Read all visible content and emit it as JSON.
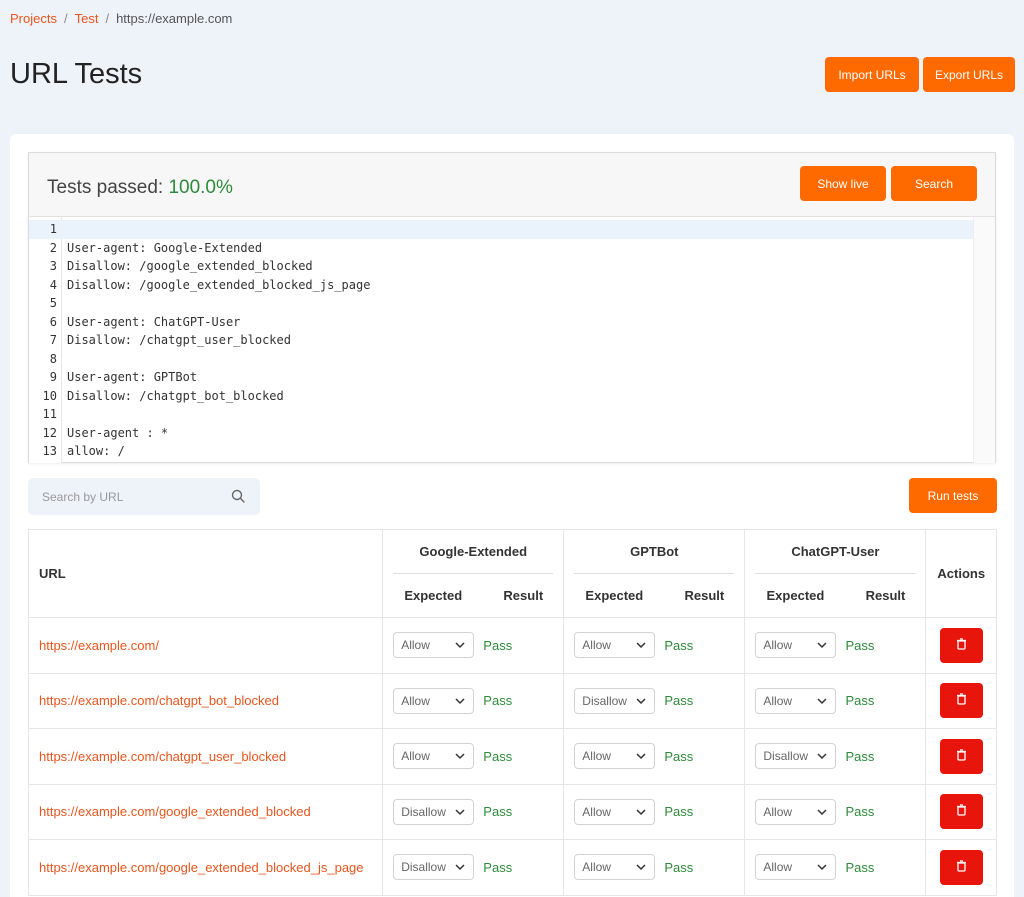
{
  "breadcrumb": {
    "projects": "Projects",
    "test": "Test",
    "current": "https://example.com",
    "separator": "/"
  },
  "page_title": "URL Tests",
  "header_buttons": {
    "import": "Import URLs",
    "export": "Export URLs"
  },
  "editor": {
    "tests_passed_label": "Tests passed:",
    "tests_passed_value": "100.0%",
    "show_live": "Show live",
    "search": "Search",
    "lines": [
      {
        "n": "1",
        "text": ""
      },
      {
        "n": "2",
        "text": "User-agent: Google-Extended"
      },
      {
        "n": "3",
        "text": "Disallow: /google_extended_blocked"
      },
      {
        "n": "4",
        "text": "Disallow: /google_extended_blocked_js_page"
      },
      {
        "n": "5",
        "text": ""
      },
      {
        "n": "6",
        "text": "User-agent: ChatGPT-User"
      },
      {
        "n": "7",
        "text": "Disallow: /chatgpt_user_blocked"
      },
      {
        "n": "8",
        "text": ""
      },
      {
        "n": "9",
        "text": "User-agent: GPTBot"
      },
      {
        "n": "10",
        "text": "Disallow: /chatgpt_bot_blocked"
      },
      {
        "n": "11",
        "text": ""
      },
      {
        "n": "12",
        "text": "User-agent : *"
      },
      {
        "n": "13",
        "text": "allow: /"
      }
    ]
  },
  "search": {
    "placeholder": "Search by URL"
  },
  "run_tests": "Run tests",
  "table": {
    "url_header": "URL",
    "groups": [
      "Google-Extended",
      "GPTBot",
      "ChatGPT-User"
    ],
    "expected_header": "Expected",
    "result_header": "Result",
    "actions_header": "Actions",
    "rows": [
      {
        "url": "https://example.com/",
        "cells": [
          {
            "expected": "Allow",
            "result": "Pass"
          },
          {
            "expected": "Allow",
            "result": "Pass"
          },
          {
            "expected": "Allow",
            "result": "Pass"
          }
        ]
      },
      {
        "url": "https://example.com/chatgpt_bot_blocked",
        "cells": [
          {
            "expected": "Allow",
            "result": "Pass"
          },
          {
            "expected": "Disallow",
            "result": "Pass"
          },
          {
            "expected": "Allow",
            "result": "Pass"
          }
        ]
      },
      {
        "url": "https://example.com/chatgpt_user_blocked",
        "cells": [
          {
            "expected": "Allow",
            "result": "Pass"
          },
          {
            "expected": "Allow",
            "result": "Pass"
          },
          {
            "expected": "Disallow",
            "result": "Pass"
          }
        ]
      },
      {
        "url": "https://example.com/google_extended_blocked",
        "cells": [
          {
            "expected": "Disallow",
            "result": "Pass"
          },
          {
            "expected": "Allow",
            "result": "Pass"
          },
          {
            "expected": "Allow",
            "result": "Pass"
          }
        ]
      },
      {
        "url": "https://example.com/google_extended_blocked_js_page",
        "cells": [
          {
            "expected": "Disallow",
            "result": "Pass"
          },
          {
            "expected": "Allow",
            "result": "Pass"
          },
          {
            "expected": "Allow",
            "result": "Pass"
          }
        ]
      }
    ]
  },
  "colors": {
    "accent": "#ff6a00",
    "link": "#e8551e",
    "pass": "#2e8b3a",
    "danger": "#e8150c"
  }
}
